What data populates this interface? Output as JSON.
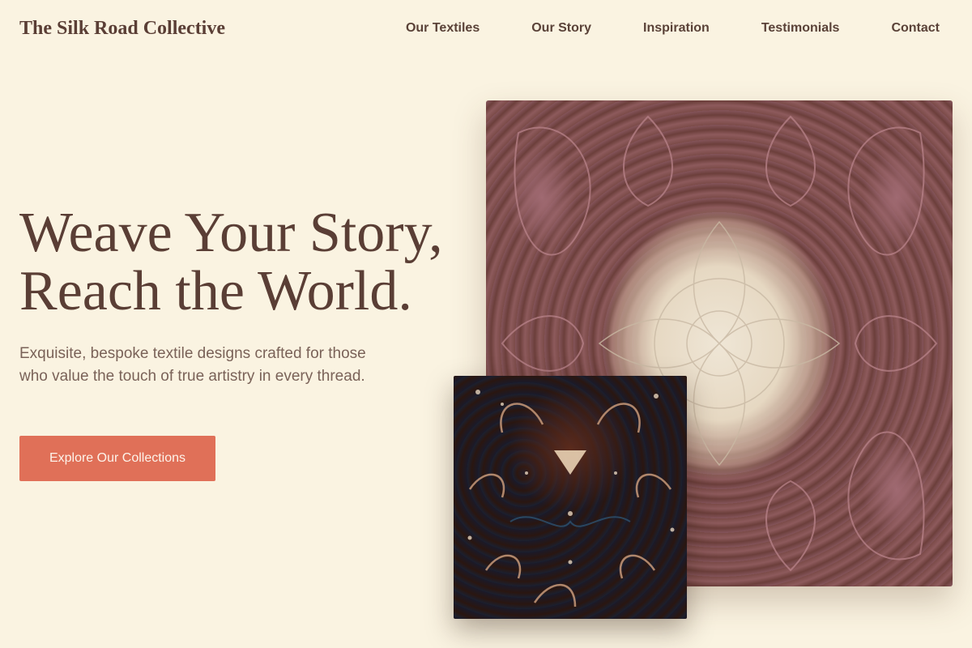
{
  "brand": {
    "name": "The Silk Road Collective"
  },
  "nav": {
    "items": [
      "Our Textiles",
      "Our Story",
      "Inspiration",
      "Testimonials",
      "Contact"
    ]
  },
  "hero": {
    "title_line1": "Weave Your Story,",
    "title_line2": "Reach the World.",
    "subtitle": "Exquisite, bespoke textile designs crafted for those who value the touch of true artistry in every thread.",
    "cta_label": "Explore Our Collections"
  },
  "colors": {
    "background": "#faf3e1",
    "text": "#5a3e35",
    "accent": "#e07058"
  },
  "images": {
    "large": "paisley-shawl-textile",
    "small": "batik-textile"
  }
}
